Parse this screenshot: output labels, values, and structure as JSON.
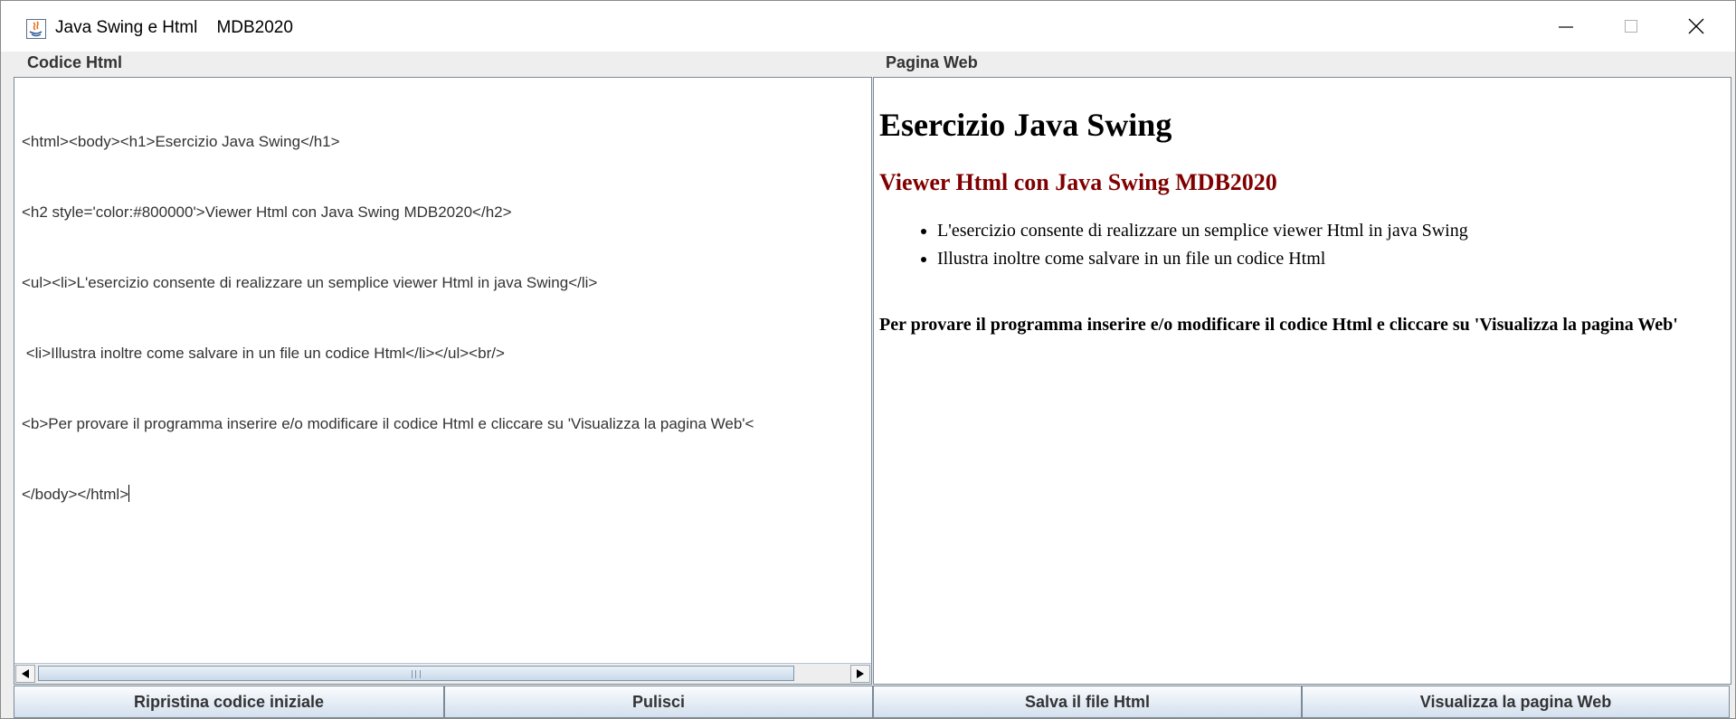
{
  "window": {
    "title": "Java Swing e Html    MDB2020",
    "controls": {
      "minimize_icon": "minimize-icon",
      "maximize_icon": "maximize-icon",
      "close_icon": "close-icon"
    }
  },
  "panels": {
    "left_title": "Codice Html",
    "right_title": "Pagina Web"
  },
  "editor": {
    "lines": [
      "<html><body><h1>Esercizio Java Swing</h1>",
      "<h2 style='color:#800000'>Viewer Html con Java Swing MDB2020</h2>",
      "<ul><li>L'esercizio consente di realizzare un semplice viewer Html in java Swing</li>",
      " <li>Illustra inoltre come salvare in un file un codice Html</li></ul><br/>",
      "<b>Per provare il programma inserire e/o modificare il codice Html e cliccare su 'Visualizza la pagina Web'<",
      "</body></html>"
    ]
  },
  "preview": {
    "heading": "Esercizio Java Swing",
    "subheading": "Viewer Html con Java Swing MDB2020",
    "subheading_color": "#800000",
    "items": [
      "L'esercizio consente di realizzare un semplice viewer Html in java Swing",
      "Illustra inoltre come salvare in un file un codice Html"
    ],
    "bold_text": "Per provare il programma inserire e/o modificare il codice Html e cliccare su 'Visualizza la pagina Web'"
  },
  "buttons": {
    "reset": "Ripristina codice iniziale",
    "clear": "Pulisci",
    "save": "Salva il file Html",
    "view": "Visualizza la pagina Web"
  }
}
